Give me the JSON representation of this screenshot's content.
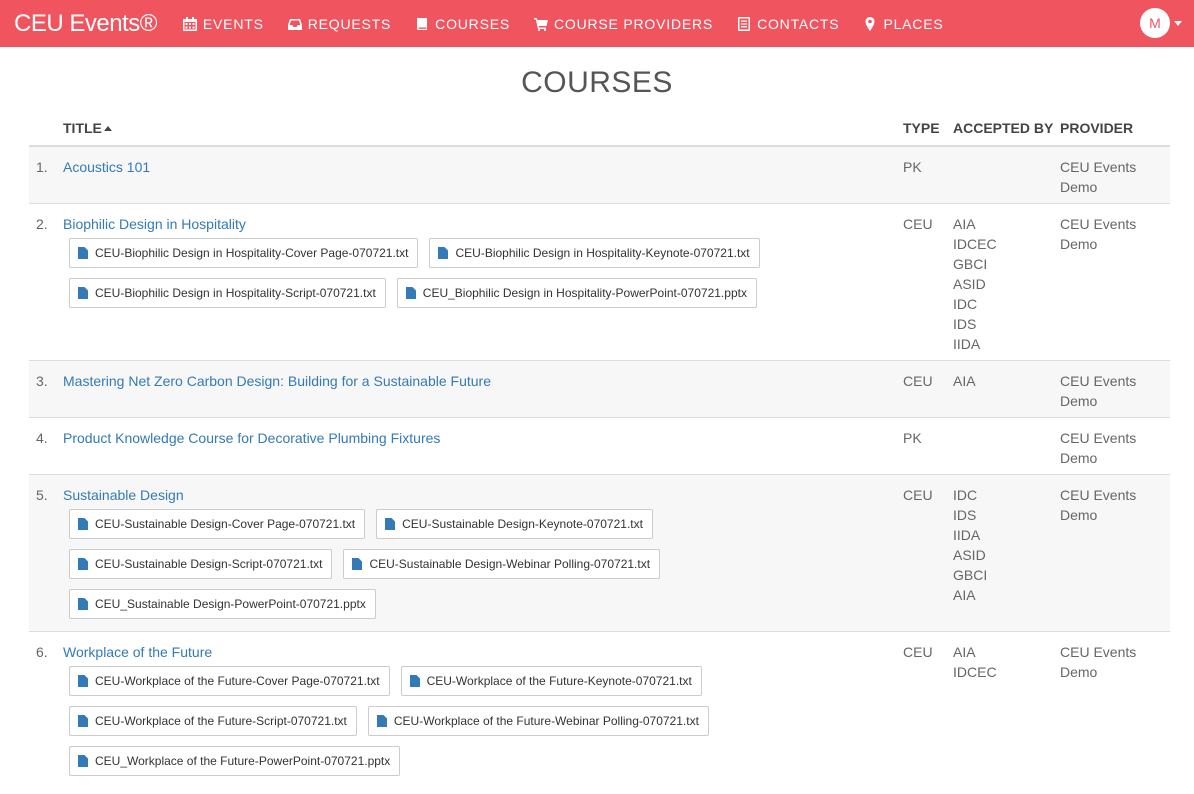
{
  "brand": "CEU Events®",
  "nav": [
    {
      "label": "EVENTS",
      "icon": "calendar-icon"
    },
    {
      "label": "REQUESTS",
      "icon": "inbox-icon"
    },
    {
      "label": "COURSES",
      "icon": "book-icon"
    },
    {
      "label": "COURSE PROVIDERS",
      "icon": "cart-icon"
    },
    {
      "label": "CONTACTS",
      "icon": "address-book-icon"
    },
    {
      "label": "PLACES",
      "icon": "map-marker-icon"
    }
  ],
  "user": {
    "initial": "M"
  },
  "page_title": "COURSES",
  "columns": {
    "title": "TITLE",
    "type": "TYPE",
    "accepted_by": "ACCEPTED BY",
    "provider": "PROVIDER"
  },
  "courses": [
    {
      "num": "1.",
      "title": "Acoustics 101",
      "type": "PK",
      "accepted_by": [],
      "provider": [
        "CEU Events",
        "Demo"
      ],
      "files": []
    },
    {
      "num": "2.",
      "title": "Biophilic Design in Hospitality",
      "type": "CEU",
      "accepted_by": [
        "AIA",
        "IDCEC",
        "GBCI",
        "ASID",
        "IDC",
        "IDS",
        "IIDA"
      ],
      "provider": [
        "CEU Events",
        "Demo"
      ],
      "files": [
        "CEU-Biophilic Design in Hospitality-Cover Page-070721.txt",
        "CEU-Biophilic Design in Hospitality-Keynote-070721.txt",
        "CEU-Biophilic Design in Hospitality-Script-070721.txt",
        "CEU_Biophilic Design in Hospitality-PowerPoint-070721.pptx"
      ]
    },
    {
      "num": "3.",
      "title": "Mastering Net Zero Carbon Design: Building for a Sustainable Future",
      "type": "CEU",
      "accepted_by": [
        "AIA"
      ],
      "provider": [
        "CEU Events",
        "Demo"
      ],
      "files": []
    },
    {
      "num": "4.",
      "title": "Product Knowledge Course for Decorative Plumbing Fixtures",
      "type": "PK",
      "accepted_by": [],
      "provider": [
        "CEU Events",
        "Demo"
      ],
      "files": []
    },
    {
      "num": "5.",
      "title": "Sustainable Design",
      "type": "CEU",
      "accepted_by": [
        "IDC",
        "IDS",
        "IIDA",
        "ASID",
        "GBCI",
        "AIA"
      ],
      "provider": [
        "CEU Events",
        "Demo"
      ],
      "files": [
        "CEU-Sustainable Design-Cover Page-070721.txt",
        "CEU-Sustainable Design-Keynote-070721.txt",
        "CEU-Sustainable Design-Script-070721.txt",
        "CEU-Sustainable Design-Webinar Polling-070721.txt",
        "CEU_Sustainable Design-PowerPoint-070721.pptx"
      ]
    },
    {
      "num": "6.",
      "title": "Workplace of the Future",
      "type": "CEU",
      "accepted_by": [
        "AIA",
        "IDCEC"
      ],
      "provider": [
        "CEU Events",
        "Demo"
      ],
      "files": [
        "CEU-Workplace of the Future-Cover Page-070721.txt",
        "CEU-Workplace of the Future-Keynote-070721.txt",
        "CEU-Workplace of the Future-Script-070721.txt",
        "CEU-Workplace of the Future-Webinar Polling-070721.txt",
        "CEU_Workplace of the Future-PowerPoint-070721.pptx"
      ]
    }
  ]
}
